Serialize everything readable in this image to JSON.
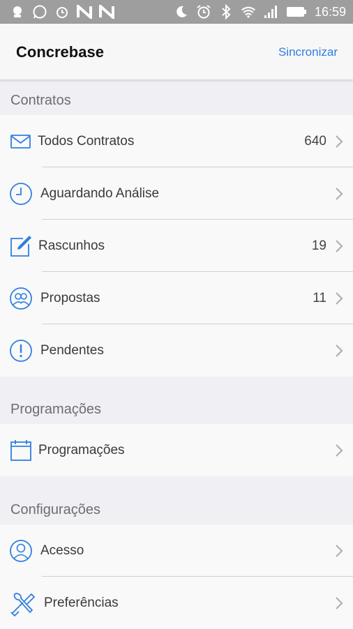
{
  "status_bar": {
    "time": "16:59",
    "left_icons": [
      "notification-icon",
      "whatsapp-icon",
      "alarm-icon",
      "n-app-icon",
      "n-app-icon"
    ],
    "right_icons": [
      "moon-icon",
      "alarm-clock-icon",
      "bluetooth-icon",
      "wifi-icon",
      "signal-icon",
      "battery-icon"
    ]
  },
  "navbar": {
    "title": "Concrebase",
    "action": "Sincronizar",
    "action_color": "#2f7fe0"
  },
  "sections": [
    {
      "header": "Contratos",
      "rows": [
        {
          "label": "Todos Contratos",
          "count": "640",
          "icon": "envelope-icon"
        },
        {
          "label": "Aguardando Análise",
          "count": "",
          "icon": "clock-icon"
        },
        {
          "label": "Rascunhos",
          "count": "19",
          "icon": "edit-icon"
        },
        {
          "label": "Propostas",
          "count": "11",
          "icon": "people-icon"
        },
        {
          "label": "Pendentes",
          "count": "",
          "icon": "alert-icon"
        }
      ]
    },
    {
      "header": "Programações",
      "rows": [
        {
          "label": "Programações",
          "count": "",
          "icon": "calendar-icon"
        }
      ]
    },
    {
      "header": "Configurações",
      "rows": [
        {
          "label": "Acesso",
          "count": "",
          "icon": "user-icon"
        },
        {
          "label": "Preferências",
          "count": "",
          "icon": "tools-icon"
        }
      ]
    }
  ],
  "colors": {
    "accent": "#2f7fe0",
    "icon_blue": "#2f7fe0"
  }
}
